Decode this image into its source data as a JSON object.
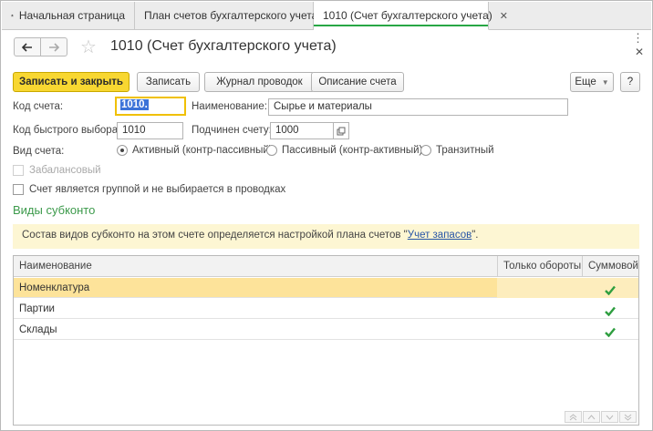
{
  "tabs": [
    {
      "label": "Начальная страница",
      "icon": "home-icon"
    },
    {
      "label": "План счетов бухгалтерского учета",
      "close": "✕"
    },
    {
      "label": "1010 (Счет бухгалтерского учета)",
      "close": "✕"
    }
  ],
  "header": {
    "title": "1010 (Счет бухгалтерского учета)",
    "back": "🡐",
    "forward": "🡒"
  },
  "toolbar": {
    "save_close": "Записать и закрыть",
    "save": "Записать",
    "journal": "Журнал проводок",
    "description": "Описание счета",
    "more": "Еще",
    "help": "?"
  },
  "form": {
    "code_label": "Код счета:",
    "code_value": "1010.",
    "name_label": "Наименование:",
    "name_value": "Сырье и материалы",
    "quick_code_label": "Код быстрого выбора:",
    "quick_code_value": "1010",
    "parent_label": "Подчинен счету:",
    "parent_value": "1000",
    "type_label": "Вид счета:",
    "type_options": [
      "Активный (контр-пассивный)",
      "Пассивный (контр-активный)",
      "Транзитный"
    ],
    "type_selected": 0,
    "off_balance_label": "Забалансовый",
    "group_label": "Счет является группой и не выбирается в проводках"
  },
  "subconto": {
    "section_title": "Виды субконто",
    "info_prefix": "Состав видов субконто на этом счете определяется настройкой плана счетов \"",
    "info_link": "Учет запасов",
    "info_suffix": "\".",
    "columns": [
      "Наименование",
      "Только обороты",
      "Суммовой"
    ],
    "rows": [
      {
        "name": "Номенклатура",
        "turnover_only": false,
        "sum": true
      },
      {
        "name": "Партии",
        "turnover_only": false,
        "sum": true
      },
      {
        "name": "Склады",
        "turnover_only": false,
        "sum": true
      }
    ]
  },
  "colors": {
    "accent_green": "#28a745",
    "primary_button": "#f8d731",
    "section_title": "#3c9a4b",
    "selected_row": "#fde39a",
    "check": "#2e9e3f"
  }
}
